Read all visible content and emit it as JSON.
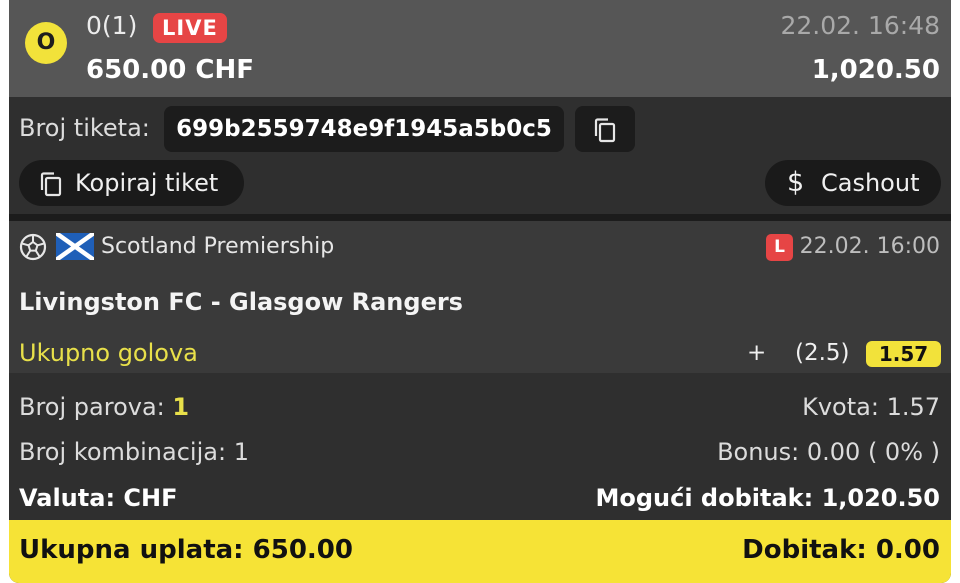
{
  "header": {
    "status_letter": "O",
    "count": "0(1)",
    "live_label": "LIVE",
    "date": "22.02. 16:48",
    "stake": "650.00 CHF",
    "payout": "1,020.50"
  },
  "ticket": {
    "label": "Broj tiketa:",
    "id": "699b2559748e9f1945a5b0c5",
    "copy_ticket_label": "Kopiraj tiket",
    "cashout_label": "Cashout",
    "cashout_symbol": "$"
  },
  "match": {
    "league": "Scotland Premiership",
    "live_letter": "L",
    "date": "22.02. 16:00",
    "teams": "Livingston FC - Glasgow Rangers",
    "market": "Ukupno golova",
    "selection_sign": "+",
    "selection_line": "(2.5)",
    "odd": "1.57"
  },
  "summary": {
    "pairs_label": "Broj parova:",
    "pairs_value": "1",
    "odds_label": "Kvota:",
    "odds_value": "1.57",
    "combinations_label": "Broj kombinacija:",
    "combinations_value": "1",
    "bonus_label": "Bonus:",
    "bonus_value": "0.00 ( 0% )",
    "currency_label": "Valuta:",
    "currency_value": "CHF",
    "possible_win_label": "Mogući dobitak:",
    "possible_win_value": "1,020.50"
  },
  "footer": {
    "total_stake_label": "Ukupna uplata:",
    "total_stake_value": "650.00",
    "win_label": "Dobitak:",
    "win_value": "0.00"
  },
  "colors": {
    "accent_yellow": "#f6e336",
    "live_red": "#e64545",
    "card_bg": "#2f2f2f",
    "header_bg": "#565656"
  }
}
